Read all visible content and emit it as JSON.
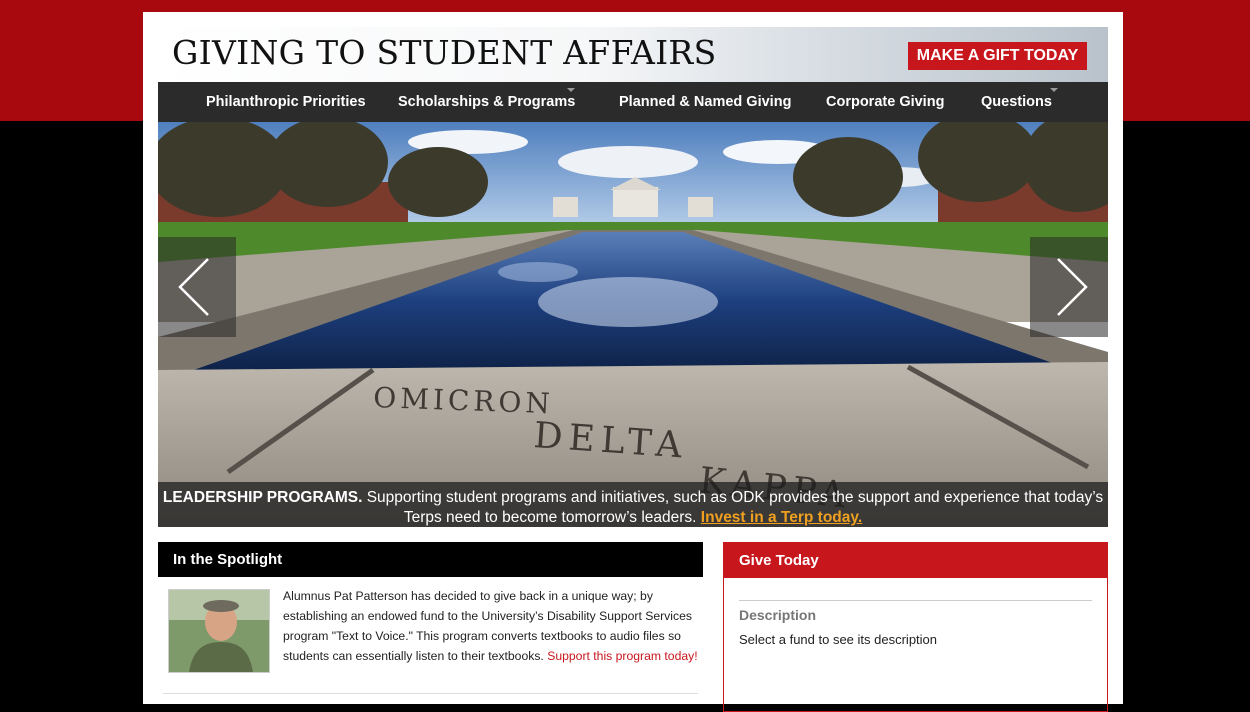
{
  "header": {
    "title": "GIVING TO STUDENT AFFAIRS",
    "cta_label": "MAKE A GIFT TODAY"
  },
  "nav": {
    "items": [
      {
        "label": "Philanthropic Priorities",
        "has_dropdown": false
      },
      {
        "label": "Scholarships & Programs",
        "has_dropdown": true
      },
      {
        "label": "Planned & Named Giving",
        "has_dropdown": false
      },
      {
        "label": "Corporate Giving",
        "has_dropdown": false
      },
      {
        "label": "Questions",
        "has_dropdown": true
      }
    ]
  },
  "hero": {
    "engraving_line1": "OMICRON",
    "engraving_line2": "DELTA",
    "engraving_line3": "KAPPA",
    "caption_heading": "LEADERSHIP PROGRAMS.",
    "caption_text": "Supporting student programs and initiatives, such as ODK provides the support and experience that today’s Terps need to become tomorrow’s leaders.",
    "caption_link": "Invest in a Terp today.",
    "prev_icon": "chevron-left-icon",
    "next_icon": "chevron-right-icon"
  },
  "spotlight": {
    "heading": "In the Spotlight",
    "body": "Alumnus Pat Patterson has decided to give back in a unique way; by establishing an endowed fund to the University’s Disability Support Services program \"Text to Voice.\" This program converts textbooks to audio files so students can essentially listen to their textbooks.",
    "link": "Support this program today!"
  },
  "give": {
    "heading": "Give Today",
    "description_label": "Description",
    "description_text": "Select a fund to see its description"
  },
  "colors": {
    "brand_red": "#c8161d",
    "top_band": "#a8090f",
    "nav_bg": "#2b2b2b",
    "cta_link": "#f0a020"
  }
}
